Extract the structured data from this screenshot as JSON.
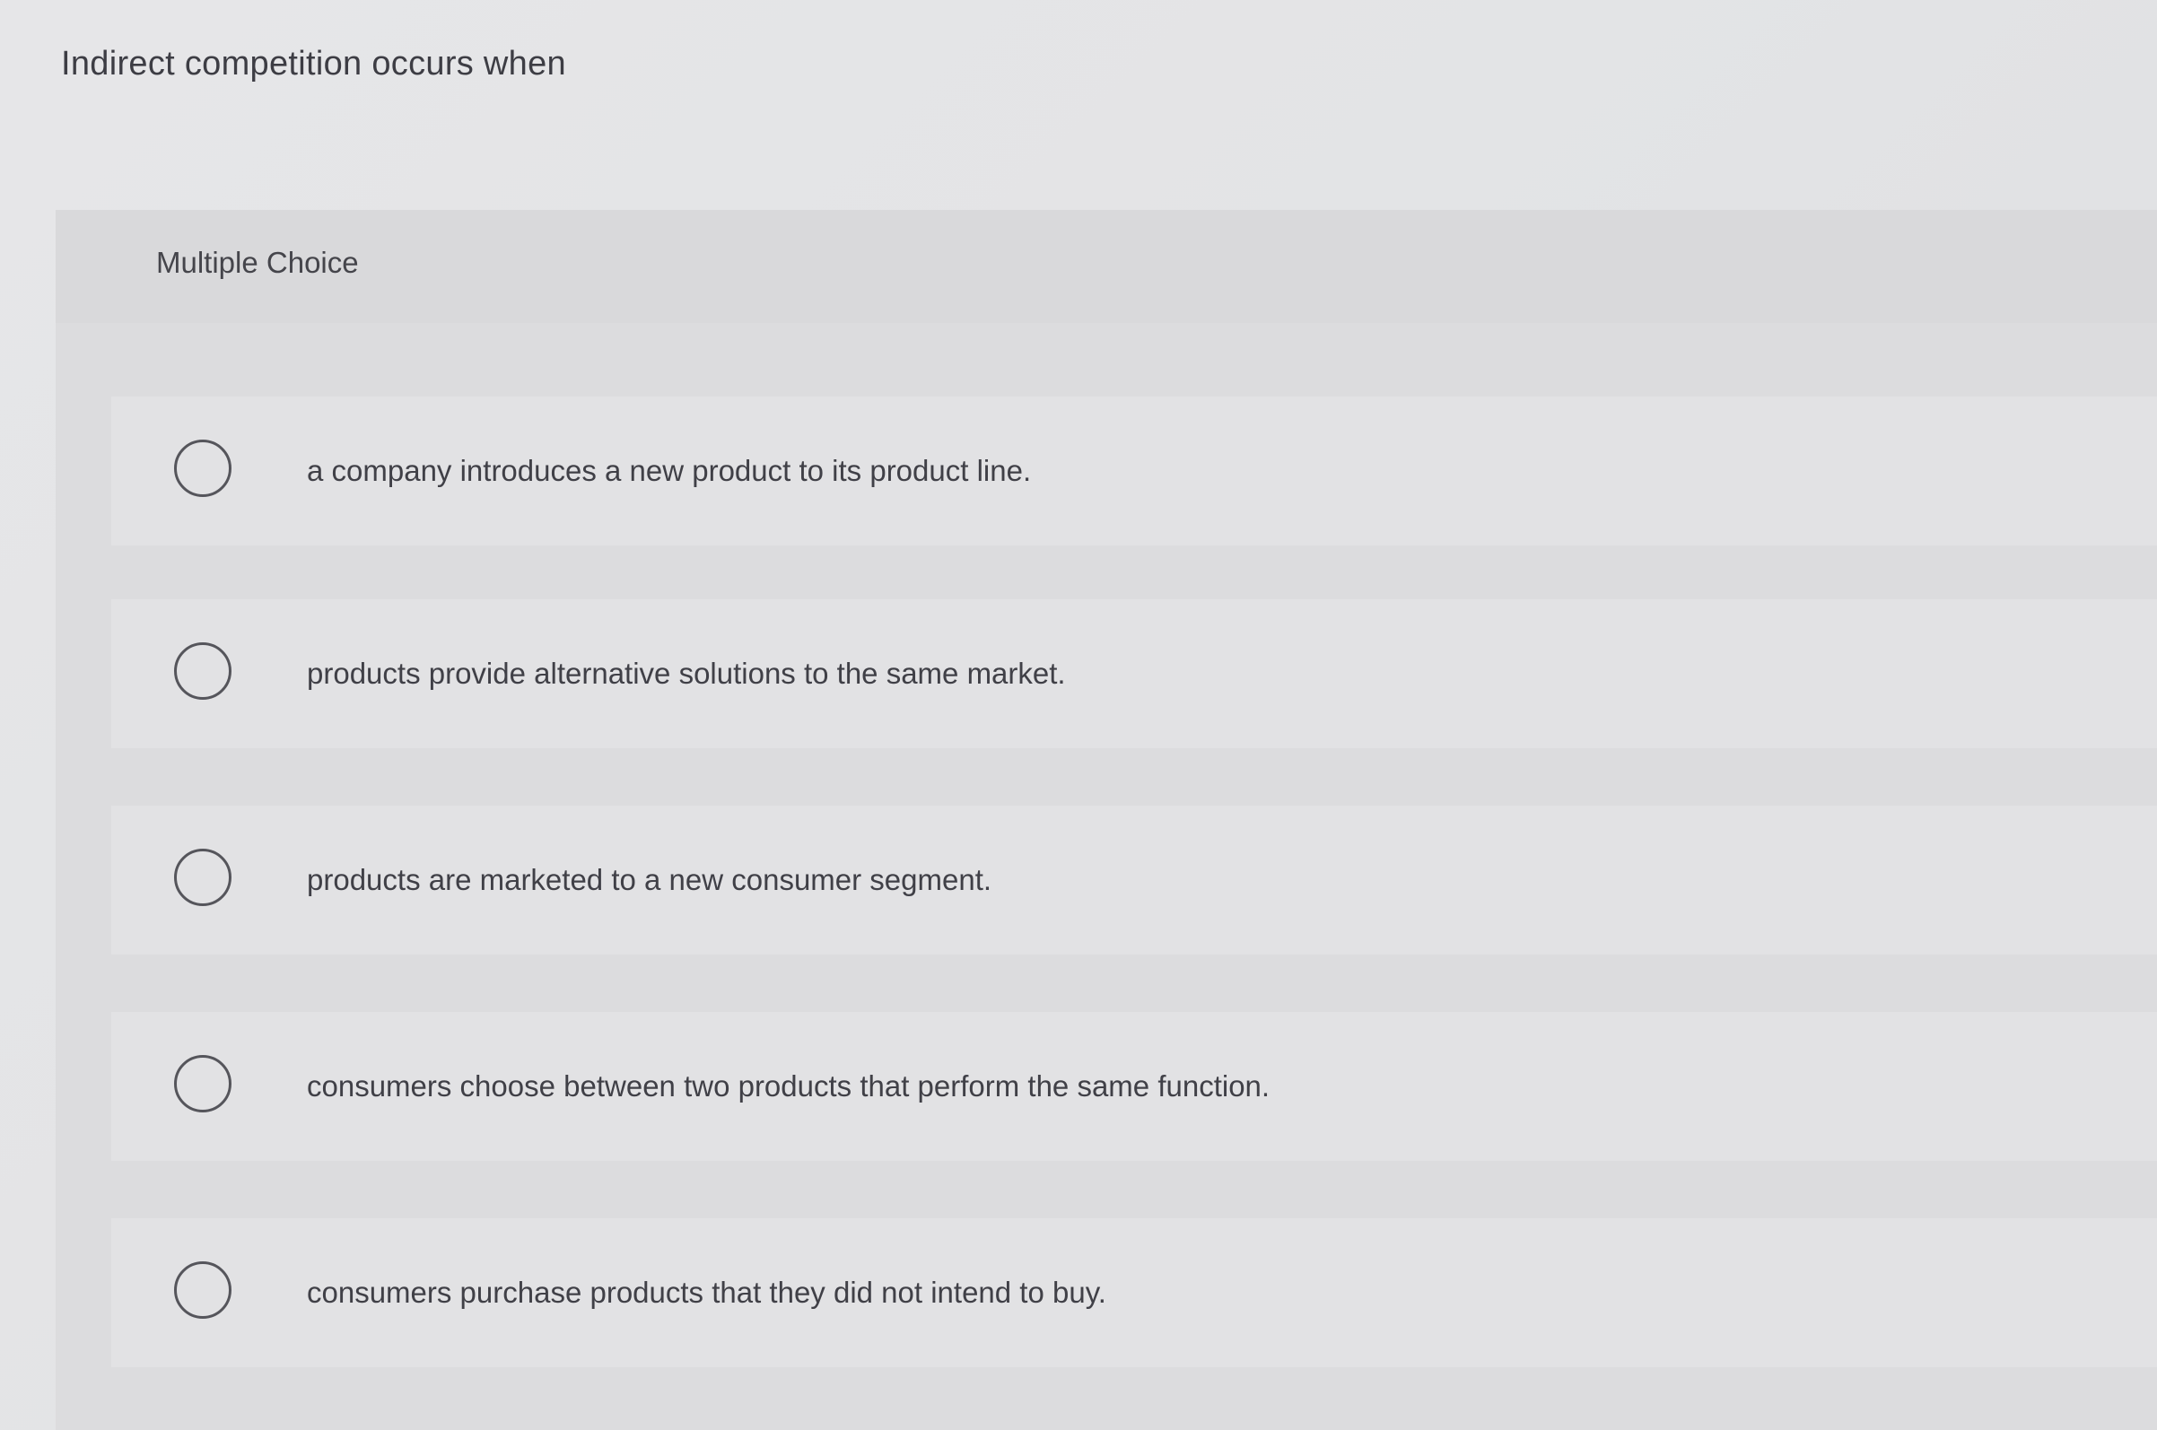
{
  "question": {
    "text": "Indirect competition occurs when"
  },
  "panel": {
    "label": "Multiple Choice"
  },
  "options": [
    {
      "text": "a company introduces a new product to its product line."
    },
    {
      "text": "products provide alternative solutions to the same market."
    },
    {
      "text": "products are marketed to a new consumer segment."
    },
    {
      "text": "consumers choose between two products that perform the same function."
    },
    {
      "text": "consumers purchase products that they did not intend to buy."
    }
  ],
  "colors": {
    "background": "#e4e4e6",
    "panel": "#dcdcde",
    "option_row": "#e2e2e4",
    "text": "#404047",
    "radio_border": "#55555b"
  },
  "icons": {
    "radio": "empty-circle"
  }
}
